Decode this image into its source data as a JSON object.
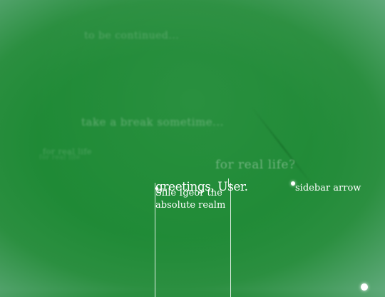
{
  "scene": {
    "background_color": "#1f8a36",
    "ghost_texts": {
      "to_be_continued": "to be continued...",
      "take_a_break": "take a break sometime...",
      "for_real_life_small": "for real life",
      "for_real_life_echo": "for real life",
      "for_real_life_large": "for real life?"
    }
  },
  "dialog": {
    "greeting": "greetings, User.",
    "subtitle": "Slile Igeor the absolute realm"
  },
  "sidebar": {
    "arrow_icon": "circle-dot",
    "label": "sidebar arrow"
  }
}
